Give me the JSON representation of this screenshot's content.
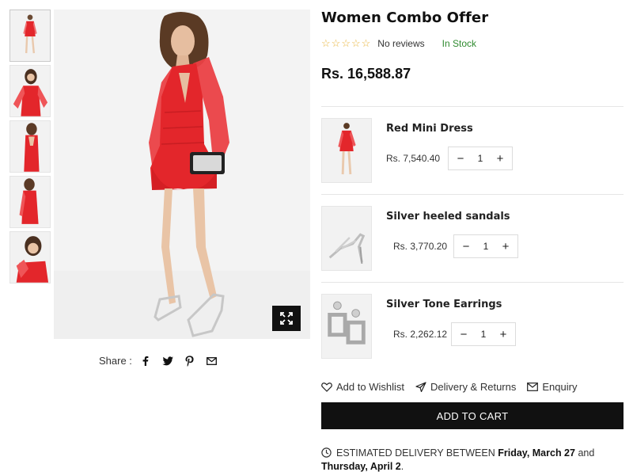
{
  "product": {
    "title": "Women Combo Offer",
    "reviews_text": "No reviews",
    "stock_text": "In Stock",
    "rating": 0,
    "rating_max": 5,
    "price": "Rs. 16,588.87"
  },
  "gallery": {
    "thumbnails": [
      "thumb-1",
      "thumb-2",
      "thumb-3",
      "thumb-4",
      "thumb-5"
    ],
    "zoom_icon": "expand-icon"
  },
  "share": {
    "label": "Share :",
    "icons": [
      "facebook-icon",
      "twitter-icon",
      "pinterest-icon",
      "email-icon"
    ]
  },
  "combo": [
    {
      "name": "Red Mini Dress",
      "price": "Rs. 7,540.40",
      "qty": "1"
    },
    {
      "name": "Silver heeled sandals",
      "price": "Rs. 3,770.20",
      "qty": "1"
    },
    {
      "name": "Silver Tone Earrings",
      "price": "Rs. 2,262.12",
      "qty": "1"
    }
  ],
  "actions": {
    "wishlist": "Add to Wishlist",
    "delivery": "Delivery & Returns",
    "enquiry": "Enquiry"
  },
  "cart": {
    "label": "ADD TO CART"
  },
  "delivery_info": {
    "prefix": "ESTIMATED DELIVERY BETWEEN",
    "start": "Friday, March 27",
    "joiner": "and",
    "end": "Thursday, April 2",
    "suffix": "."
  },
  "colors": {
    "accent": "#111111",
    "stock": "#2f8a2f",
    "star": "#e8b43a",
    "dress": "#e3262b"
  }
}
